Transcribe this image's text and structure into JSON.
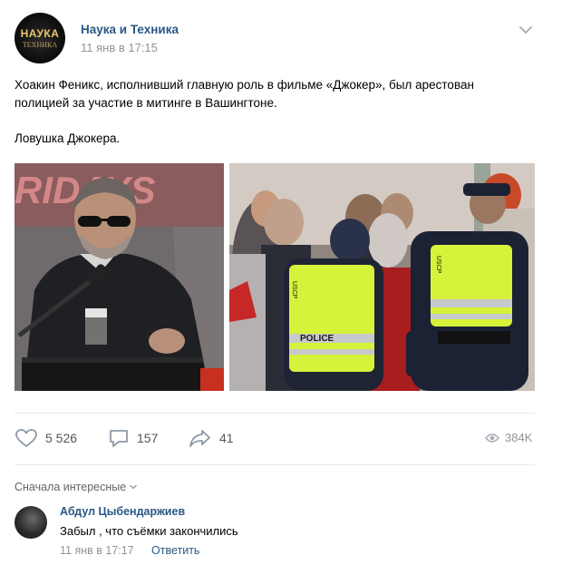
{
  "post": {
    "group_name": "Наука и Техника",
    "time": "11 янв в 17:15",
    "avatar_text_top": "НАУКА",
    "avatar_text_bottom": "ТЕХНИКА",
    "text_line1": "Хоакин Феникс, исполнивший главную роль в фильме «Джокер», был арестован",
    "text_line2": "полицией за участие в митинге в Вашингтоне.",
    "text_line3": "Ловушка Джокера."
  },
  "photos": {
    "photo1_sign": "RIDAYS",
    "photo2_vest_left": "USCP",
    "photo2_police": "POLICE",
    "photo2_vest_right": "USCP"
  },
  "actions": {
    "likes": "5 526",
    "comments": "157",
    "shares": "41",
    "views": "384K"
  },
  "comments": {
    "sort_label": "Сначала интересные",
    "items": [
      {
        "author": "Абдул Цыбендаржиев",
        "text": "Забыл , что съёмки закончились",
        "time": "11 янв в 17:17",
        "reply_label": "Ответить"
      }
    ]
  },
  "colors": {
    "link": "#2a5885",
    "muted": "#939393",
    "vest": "#d6f23a"
  }
}
